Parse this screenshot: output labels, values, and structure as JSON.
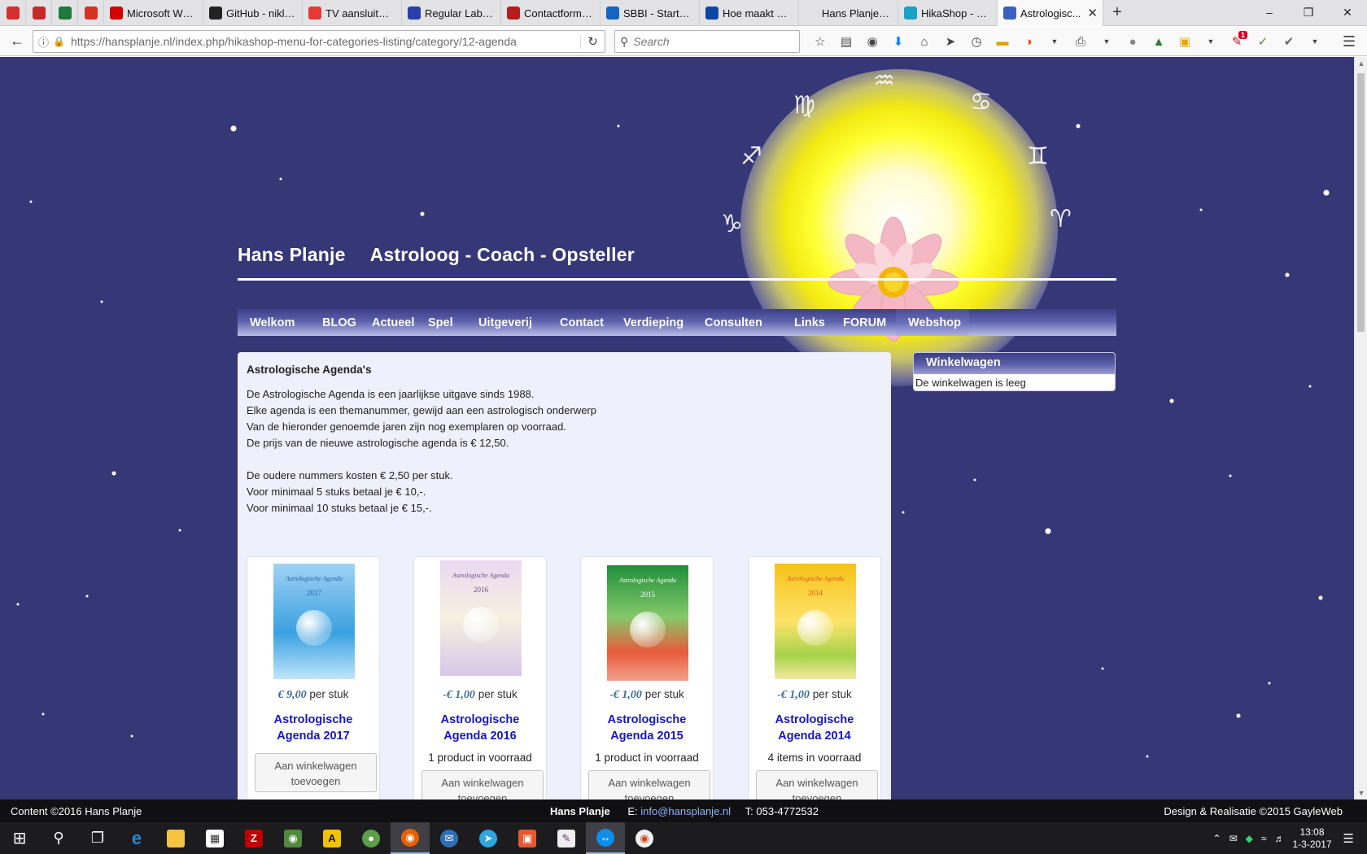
{
  "browser": {
    "tabs": [
      {
        "label": "",
        "icon": "app-icon",
        "color": "#d32f2f",
        "pinned": true
      },
      {
        "label": "",
        "icon": "app-icon",
        "color": "#c62828",
        "pinned": true
      },
      {
        "label": "",
        "icon": "bookmark-icon",
        "color": "#1e7a3c",
        "pinned": true
      },
      {
        "label": "",
        "icon": "gmail-icon",
        "color": "#d93025",
        "pinned": true
      },
      {
        "label": "Microsoft Wor...",
        "icon": "alert-icon",
        "color": "#d50000"
      },
      {
        "label": "GitHub - niklau...",
        "icon": "github-icon",
        "color": "#222222"
      },
      {
        "label": "TV aansluiten v...",
        "icon": "tv-icon",
        "color": "#e53935"
      },
      {
        "label": "Regular Labs - ...",
        "icon": "regularlabs-icon",
        "color": "#2840a8"
      },
      {
        "label": "Contactformuli...",
        "icon": "kdw-icon",
        "color": "#b71c1c"
      },
      {
        "label": "SBBI - StartStic...",
        "icon": "shield-icon",
        "color": "#1565c0"
      },
      {
        "label": "Hoe maakt u g...",
        "icon": "doc-icon",
        "color": "#0d47a1"
      },
      {
        "label": "Hans Planje - Astrol...",
        "icon": "",
        "color": "#e3e3e6"
      },
      {
        "label": "HikaShop - Ne...",
        "icon": "hikashop-icon",
        "color": "#1aa2c4"
      },
      {
        "label": "Astrologisc...",
        "icon": "hikashop-icon",
        "color": "#3a5fbf",
        "active": true
      }
    ],
    "url_host": "https://hansplanje.nl",
    "url_path": "/index.php/hikashop-menu-for-categories-listing/category/12-agenda",
    "search_placeholder": "Search"
  },
  "site": {
    "owner": "Hans Planje",
    "tagline": "Astroloog - Coach - Opsteller",
    "menu": [
      "Welkom",
      "BLOG",
      "Actueel",
      "Spel",
      "Uitgeverij",
      "Contact",
      "Verdieping",
      "Consulten",
      "Links",
      "FORUM",
      "Webshop"
    ],
    "menu_active": "Webshop"
  },
  "content": {
    "heading": "Astrologische Agenda's",
    "paragraphs": [
      "De Astrologische Agenda is een jaarlijkse uitgave sinds 1988.",
      "Elke agenda is een themanummer, gewijd aan een astrologisch onderwerp",
      "Van de hieronder genoemde jaren zijn nog exemplaren op voorraad.",
      "De prijs van de nieuwe astrologische agenda is € 12,50.",
      "",
      "De oudere nummers kosten € 2,50 per stuk.",
      "Voor minimaal 5 stuks betaal je € 10,-.",
      "Voor minimaal 10 stuks betaal je € 15,-."
    ],
    "products": [
      {
        "price": "€ 9,00",
        "unit": "per stuk",
        "name_line1": "Astrologische",
        "name_line2": "Agenda 2017",
        "stock": "",
        "button_line1": "Aan winkelwagen",
        "button_line2": "toevoegen",
        "cover_title": "Astrologische Agenda",
        "cover_year": "2017"
      },
      {
        "price": "-€ 1,00",
        "unit": "per stuk",
        "name_line1": "Astrologische",
        "name_line2": "Agenda 2016",
        "stock": "1 product in voorraad",
        "button_line1": "Aan winkelwagen",
        "button_line2": "toevoegen",
        "cover_title": "Astrologische Agenda",
        "cover_year": "2016"
      },
      {
        "price": "-€ 1,00",
        "unit": "per stuk",
        "name_line1": "Astrologische",
        "name_line2": "Agenda 2015",
        "stock": "1 product in voorraad",
        "button_line1": "Aan winkelwagen",
        "button_line2": "toevoegen",
        "cover_title": "Astrologische Agenda",
        "cover_year": "2015"
      },
      {
        "price": "-€ 1,00",
        "unit": "per stuk",
        "name_line1": "Astrologische",
        "name_line2": "Agenda 2014",
        "stock": "4 items in voorraad",
        "button_line1": "Aan winkelwagen",
        "button_line2": "toevoegen",
        "cover_title": "Astrologische Agenda",
        "cover_year": "2014"
      }
    ]
  },
  "cart": {
    "title": "Winkelwagen",
    "empty_text": "De winkelwagen is leeg"
  },
  "footer": {
    "left": "Content ©2016 Hans Planje",
    "name": "Hans Planje",
    "email_label": "E:",
    "email": "info@hansplanje.nl",
    "phone": "T: 053-4772532",
    "right": "Design & Realisatie ©2015 GayleWeb"
  },
  "taskbar": {
    "time": "13:08",
    "date": "1-3-2017"
  }
}
